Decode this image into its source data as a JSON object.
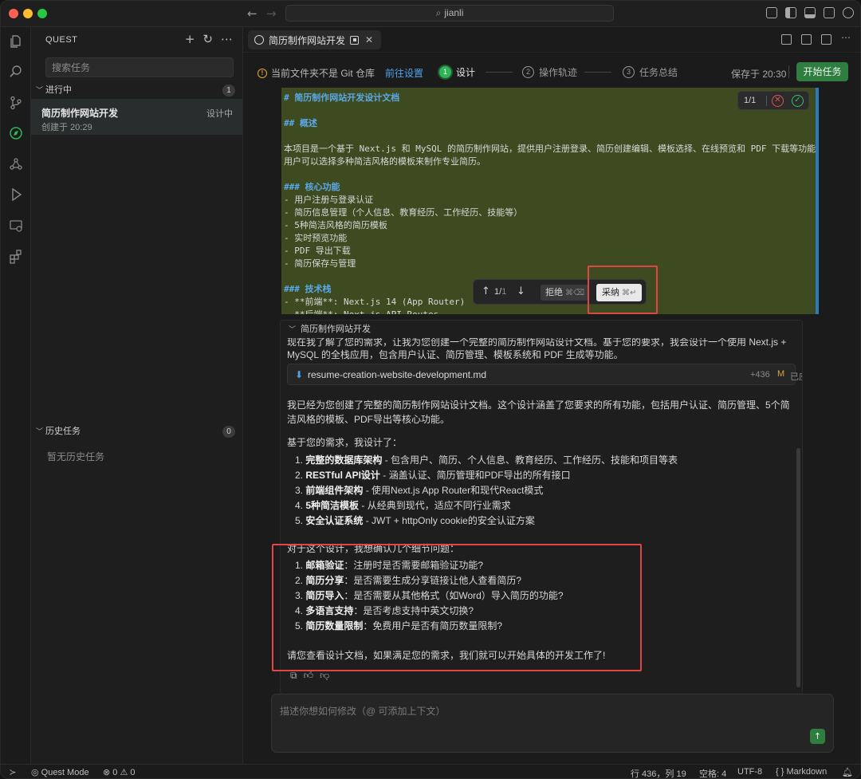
{
  "titlebar": {
    "search_text": "jianli"
  },
  "sidebar": {
    "title": "QUEST",
    "tools": [
      "+",
      "↻",
      "⋯"
    ],
    "search_placeholder": "搜索任务",
    "in_progress": {
      "label": "进行中",
      "count": "1"
    },
    "task": {
      "name": "简历制作网站开发",
      "status": "设计中",
      "created": "创建于 20:29"
    },
    "history": {
      "label": "历史任务",
      "count": "0",
      "empty": "暂无历史任务"
    }
  },
  "tab": {
    "label": "简历制作网站开发"
  },
  "steps": {
    "git_warning": "当前文件夹不是 Git 仓库",
    "git_link": "前往设置",
    "items": [
      {
        "num": "1",
        "label": "设计"
      },
      {
        "num": "2",
        "label": "操作轨迹"
      },
      {
        "num": "3",
        "label": "任务总结"
      }
    ],
    "saved": "保存于 20:30",
    "start_button": "开始任务"
  },
  "code": {
    "lines": [
      "# 简历制作网站开发设计文档",
      "",
      "## 概述",
      "",
      "本项目是一个基于 Next.js 和 MySQL 的简历制作网站，提供用户注册登录、简历创建编辑、模板选择、在线预览和 PDF 下载等功能。",
      "用户可以选择多种简洁风格的模板来制作专业简历。",
      "",
      "### 核心功能",
      "- 用户注册与登录认证",
      "- 简历信息管理（个人信息、教育经历、工作经历、技能等）",
      "- 5种简洁风格的简历模板",
      "- 实时预览功能",
      "- PDF 导出下载",
      "- 简历保存与管理",
      "",
      "### 技术栈",
      "- **前端**: Next.js 14 (App Router)",
      "- **后端**: Next.js API Routes"
    ],
    "diff_count": "1/1"
  },
  "accept_bar": {
    "page": "1/",
    "total": "1",
    "reject": "拒绝",
    "reject_key": "⌘⌫",
    "accept": "采纳",
    "accept_key": "⌘↵"
  },
  "chat": {
    "header": "简历制作网站开发",
    "cut_text": "现在我了解了您的需求，让我为您创建一个完整的简历制作网站设计文档。基于您的要求，我会设计一个使用 Next.js + MySQL 的全栈应用，包含用户认证、简历管理、模板系统和 PDF 生成等功能。",
    "file": {
      "name": "resume-creation-website-development.md",
      "added": "+436",
      "mark": "M",
      "status": "已应用"
    },
    "p1": "我已经为您创建了完整的简历制作网站设计文档。这个设计涵盖了您要求的所有功能，包括用户认证、简历管理、5个简洁风格的模板、PDF导出等核心功能。",
    "p2": "基于您的需求，我设计了：",
    "list1": [
      {
        "b": "完整的数据库架构",
        "t": " - 包含用户、简历、个人信息、教育经历、工作经历、技能和项目等表"
      },
      {
        "b": "RESTful API设计",
        "t": " - 涵盖认证、简历管理和PDF导出的所有接口"
      },
      {
        "b": "前端组件架构",
        "t": " - 使用Next.js App Router和现代React模式"
      },
      {
        "b": "5种简洁模板",
        "t": " - 从经典到现代，适应不同行业需求"
      },
      {
        "b": "安全认证系统",
        "t": " - JWT + httpOnly cookie的安全认证方案"
      }
    ],
    "p3": "对于这个设计，我想确认几个细节问题：",
    "list2": [
      {
        "b": "邮箱验证",
        "t": "：注册时是否需要邮箱验证功能?"
      },
      {
        "b": "简历分享",
        "t": "：是否需要生成分享链接让他人查看简历?"
      },
      {
        "b": "简历导入",
        "t": "：是否需要从其他格式（如Word）导入简历的功能?"
      },
      {
        "b": "多语言支持",
        "t": "：是否考虑支持中英文切换?"
      },
      {
        "b": "简历数量限制",
        "t": "：免费用户是否有简历数量限制?"
      }
    ],
    "p4": "请您查看设计文档，如果满足您的需求，我们就可以开始具体的开发工作了!"
  },
  "input": {
    "placeholder": "描述你想如何修改（@ 可添加上下文）"
  },
  "statusbar": {
    "mode": "Quest Mode",
    "errors": "⊗ 0 ⚠ 0",
    "position": "行 436，列 19",
    "spaces": "空格: 4",
    "encoding": "UTF-8",
    "language": "{ } Markdown"
  }
}
